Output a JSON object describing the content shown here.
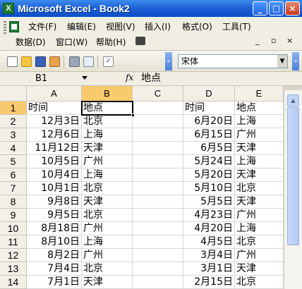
{
  "window": {
    "title": "Microsoft Excel - Book2",
    "app_icon": "X",
    "buttons": {
      "minimize": "_",
      "maximize": "□",
      "close": "×"
    }
  },
  "menu": {
    "row1": [
      "文件(F)",
      "编辑(E)",
      "视图(V)",
      "插入(I)",
      "格式(O)",
      "工具(T)"
    ],
    "row2": [
      "数据(D)",
      "窗口(W)",
      "帮助(H)"
    ],
    "doc_controls": {
      "minimize": "_",
      "restore": "▫",
      "close": "×"
    }
  },
  "toolbar": {
    "icons": [
      "new-icon",
      "open-icon",
      "save-icon",
      "permission-icon",
      "print-icon",
      "print-preview-icon",
      "spelling-icon"
    ],
    "font_name": "宋体"
  },
  "formula_bar": {
    "name_box": "B1",
    "fx": "fx",
    "content": "地点"
  },
  "sheet": {
    "columns": [
      "A",
      "B",
      "C",
      "D",
      "E"
    ],
    "selected_column": "B",
    "selected_row": "1",
    "rows": [
      {
        "n": "1",
        "A": "时间",
        "B": "地点",
        "C": "",
        "D": "时间",
        "E": "地点"
      },
      {
        "n": "2",
        "A": "12月3日",
        "B": "北京",
        "C": "",
        "D": "6月20日",
        "E": "上海"
      },
      {
        "n": "3",
        "A": "12月6日",
        "B": "上海",
        "C": "",
        "D": "6月15日",
        "E": "广州"
      },
      {
        "n": "4",
        "A": "11月12日",
        "B": "天津",
        "C": "",
        "D": "6月5日",
        "E": "天津"
      },
      {
        "n": "5",
        "A": "10月5日",
        "B": "广州",
        "C": "",
        "D": "5月24日",
        "E": "上海"
      },
      {
        "n": "6",
        "A": "10月4日",
        "B": "上海",
        "C": "",
        "D": "5月20日",
        "E": "天津"
      },
      {
        "n": "7",
        "A": "10月1日",
        "B": "北京",
        "C": "",
        "D": "5月10日",
        "E": "北京"
      },
      {
        "n": "8",
        "A": "9月8日",
        "B": "天津",
        "C": "",
        "D": "5月5日",
        "E": "天津"
      },
      {
        "n": "9",
        "A": "9月5日",
        "B": "北京",
        "C": "",
        "D": "4月23日",
        "E": "广州"
      },
      {
        "n": "10",
        "A": "8月18日",
        "B": "广州",
        "C": "",
        "D": "4月20日",
        "E": "上海"
      },
      {
        "n": "11",
        "A": "8月10日",
        "B": "上海",
        "C": "",
        "D": "4月5日",
        "E": "北京"
      },
      {
        "n": "12",
        "A": "8月2日",
        "B": "广州",
        "C": "",
        "D": "3月4日",
        "E": "广州"
      },
      {
        "n": "13",
        "A": "7月4日",
        "B": "北京",
        "C": "",
        "D": "3月1日",
        "E": "天津"
      },
      {
        "n": "14",
        "A": "7月1日",
        "B": "天津",
        "C": "",
        "D": "2月15日",
        "E": "北京"
      }
    ]
  }
}
